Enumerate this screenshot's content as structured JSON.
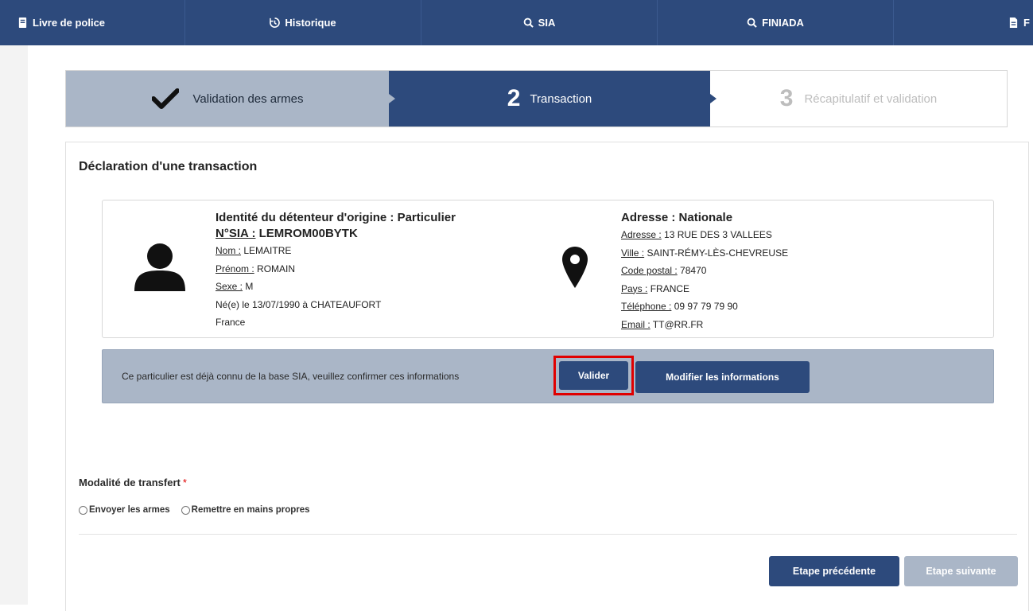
{
  "nav": {
    "items": [
      {
        "label": "Livre de police",
        "icon": "book-icon"
      },
      {
        "label": "Historique",
        "icon": "history-icon"
      },
      {
        "label": "SIA",
        "icon": "search-icon"
      },
      {
        "label": "FINIADA",
        "icon": "search-icon"
      },
      {
        "label": "F",
        "icon": "document-icon"
      }
    ]
  },
  "stepper": {
    "steps": [
      {
        "number": "",
        "label": "Validation des armes",
        "state": "completed"
      },
      {
        "number": "2",
        "label": "Transaction",
        "state": "active"
      },
      {
        "number": "3",
        "label": "Récapitulatif et validation",
        "state": "pending"
      }
    ]
  },
  "panel": {
    "title": "Déclaration d'une transaction"
  },
  "holder": {
    "heading": "Identité du détenteur d'origine : Particulier",
    "sia_label": "N°SIA :",
    "sia_value": " LEMROM00BYTK",
    "fields": [
      {
        "label": "Nom :",
        "value": " LEMAITRE"
      },
      {
        "label": "Prénom :",
        "value": " ROMAIN"
      },
      {
        "label": "Sexe :",
        "value": " M"
      }
    ],
    "birth": "Né(e) le 13/07/1990 à CHATEAUFORT",
    "country": "France"
  },
  "address": {
    "heading": "Adresse : Nationale",
    "fields": [
      {
        "label": "Adresse :",
        "value": " 13 RUE DES 3 VALLEES"
      },
      {
        "label": "Ville :",
        "value": " SAINT-RÉMY-LÈS-CHEVREUSE"
      },
      {
        "label": "Code postal :",
        "value": " 78470"
      },
      {
        "label": "Pays :",
        "value": " FRANCE"
      },
      {
        "label": "Téléphone :",
        "value": " 09 97 79 79 90"
      },
      {
        "label": "Email :",
        "value": " TT@RR.FR"
      }
    ]
  },
  "confirm": {
    "message": "Ce particulier est déjà connu de la base SIA, veuillez confirmer ces informations",
    "validate_label": "Valider",
    "modify_label": "Modifier les informations"
  },
  "transfer": {
    "label": "Modalité de transfert",
    "required_mark": "*",
    "options": [
      "Envoyer les armes",
      "Remettre en mains propres"
    ]
  },
  "footer": {
    "prev_label": "Etape précédente",
    "next_label": "Etape suivante"
  },
  "colors": {
    "primary": "#2d4a7c",
    "muted": "#aab6c7",
    "highlight": "#e00000"
  }
}
